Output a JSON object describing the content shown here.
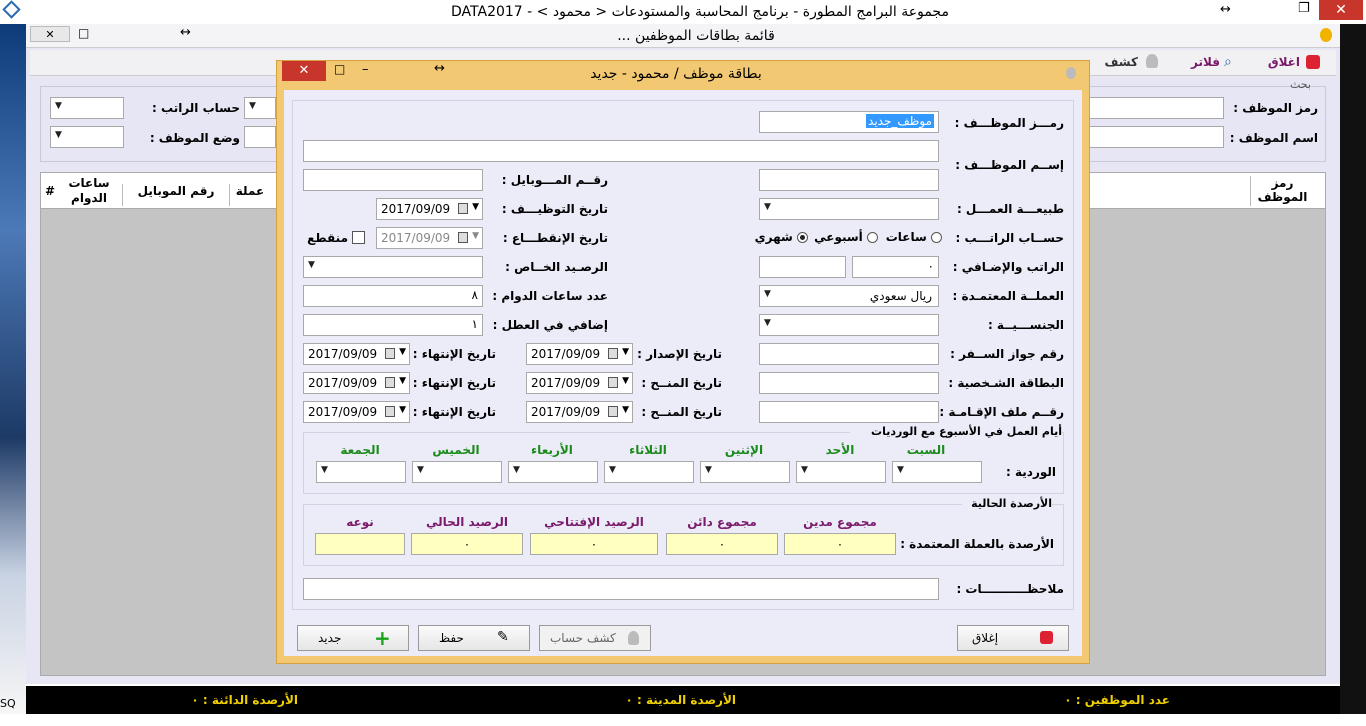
{
  "app": {
    "title": "مجموعة البرامج المطورة - برنامج المحاسبة والمستودعات < محمود > - DATA2017",
    "child_title": "قائمة بطاقات الموظفين ...",
    "toolbar": {
      "close": "اغلاق",
      "filters": "فلاتر",
      "statement": "كشف"
    },
    "search_group": "بحث",
    "search": {
      "emp_code": "رمز الموظف :",
      "emp_name": "اسم الموظف :",
      "salary_calc": "حساب الراتب :",
      "emp_status": "وضع الموظف :"
    },
    "grid_headers": [
      "رمز الموظف",
      "عملة",
      "رقم الموبايل",
      "ساعات الدوام",
      "#"
    ],
    "status": {
      "employees_count": "عدد الموظفين : ٠",
      "debit_balances": "الأرصدة المدينة : ٠",
      "credit_balances": "الأرصدة الدائنة : ٠"
    },
    "taskbar_text": "SQ"
  },
  "dialog": {
    "title": "بطاقة موظف / محمود - جديد",
    "labels": {
      "emp_code": "رمـــز الموظـــف :",
      "emp_name": "إســم الموظـــف :",
      "mobile": "رقــم المـــوبايل :",
      "work_nature": "طبيعـــة العمـــل :",
      "hire_date": "تاريخ التوظيـــف :",
      "salary_calc": "حســاب الراتـــب :",
      "interruption_date": "تاريخ الإنقطـــاع :",
      "salary_extra": "الراتب والإضـافي :",
      "special_balance": "الرصـيد الخــاص :",
      "currency": "العملــة المعتمـدة :",
      "work_hours": "عدد ساعات الدوام :",
      "nationality": "الجنســـيــة :",
      "holiday_extra": "إضافي في العطل :",
      "passport": "رقم جواز الســفر :",
      "id_card": "البطاقة الشـخصية :",
      "residence_file": "رقــم ملف الإقـامـة :",
      "issue_date": "تاريخ الإصدار :",
      "grant_date": "تاريخ المنــح :",
      "expiry_date": "تاريخ الإنتهاء :",
      "notes": "ملاحظـــــــــــات :"
    },
    "values": {
      "emp_code": "موظف_جديد",
      "emp_name": "",
      "mobile": "",
      "work_nature": "",
      "hire_date": "2017/09/09",
      "interruption_date": "2017/09/09",
      "salary": "٠",
      "extra": "",
      "currency": "ريال سعودي",
      "work_hours": "٨",
      "holiday_extra": "١",
      "dates": [
        "2017/09/09",
        "2017/09/09",
        "2017/09/09",
        "2017/09/09",
        "2017/09/09",
        "2017/09/09"
      ]
    },
    "salary_options": [
      "شهري",
      "أسبوعي",
      "ساعات"
    ],
    "salary_selected": "شهري",
    "interrupted_label": "منقطع",
    "week": {
      "title": "أيام العمل في الأسبوع مع الورديات",
      "shift_label": "الوردية :",
      "days": [
        "السبت",
        "الأحد",
        "الإثنين",
        "الثلاثاء",
        "الأربعاء",
        "الخميس",
        "الجمعة"
      ]
    },
    "balances": {
      "title": "الأرصدة الحالية",
      "row_label": "الأرصدة بالعملة المعتمدة :",
      "headers": [
        "مجموع مدين",
        "مجموع دائن",
        "الرصيد الإفتتاحي",
        "الرصيد الحالي",
        "نوعه"
      ],
      "values": [
        "٠",
        "٠",
        "٠",
        "٠",
        ""
      ]
    },
    "buttons": {
      "close": "إغلاق",
      "statement": "كشف حساب",
      "save": "حفظ",
      "new": "جديد"
    }
  }
}
